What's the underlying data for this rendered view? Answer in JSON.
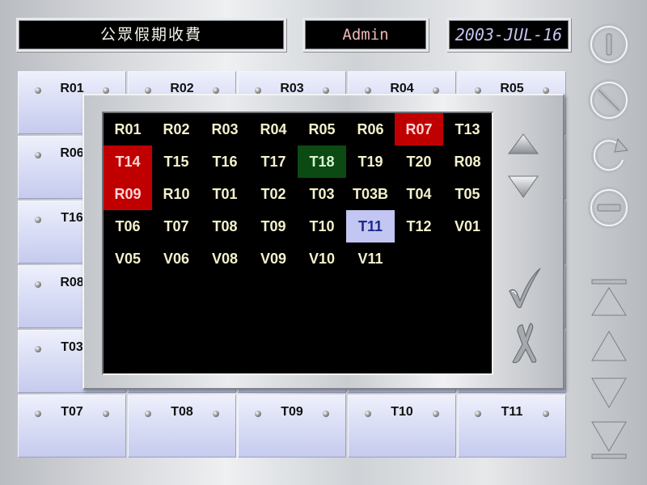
{
  "header": {
    "title": "公眾假期收費",
    "user": "Admin",
    "date": "2003-JUL-16"
  },
  "background_grid": {
    "rows": [
      [
        "R01",
        "R02",
        "R03",
        "R04",
        "R05"
      ],
      [
        "R06",
        "",
        "",
        "",
        ""
      ],
      [
        "T16",
        "",
        "",
        "",
        ""
      ],
      [
        "R08",
        "",
        "",
        "",
        ""
      ],
      [
        "T03",
        "",
        "",
        "",
        ""
      ],
      [
        "T07",
        "T08",
        "T09",
        "T10",
        "T11"
      ]
    ],
    "visible_partial_labels": [
      "R01",
      "R02",
      "R03",
      "R04",
      "R05",
      "R06",
      "T16",
      "R08",
      "T03",
      "T07",
      "T08",
      "T09",
      "T10",
      "T11"
    ]
  },
  "popup": {
    "rooms": [
      {
        "label": "R01",
        "state": "normal"
      },
      {
        "label": "R02",
        "state": "normal"
      },
      {
        "label": "R03",
        "state": "normal"
      },
      {
        "label": "R04",
        "state": "normal"
      },
      {
        "label": "R05",
        "state": "normal"
      },
      {
        "label": "R06",
        "state": "normal"
      },
      {
        "label": "R07",
        "state": "red"
      },
      {
        "label": "T13",
        "state": "normal"
      },
      {
        "label": "T14",
        "state": "red"
      },
      {
        "label": "T15",
        "state": "normal"
      },
      {
        "label": "T16",
        "state": "normal"
      },
      {
        "label": "T17",
        "state": "normal"
      },
      {
        "label": "T18",
        "state": "green"
      },
      {
        "label": "T19",
        "state": "normal"
      },
      {
        "label": "T20",
        "state": "normal"
      },
      {
        "label": "R08",
        "state": "normal"
      },
      {
        "label": "R09",
        "state": "red"
      },
      {
        "label": "R10",
        "state": "normal"
      },
      {
        "label": "T01",
        "state": "normal"
      },
      {
        "label": "T02",
        "state": "normal"
      },
      {
        "label": "T03",
        "state": "normal"
      },
      {
        "label": "T03B",
        "state": "normal"
      },
      {
        "label": "T04",
        "state": "normal"
      },
      {
        "label": "T05",
        "state": "normal"
      },
      {
        "label": "T06",
        "state": "normal"
      },
      {
        "label": "T07",
        "state": "normal"
      },
      {
        "label": "T08",
        "state": "normal"
      },
      {
        "label": "T09",
        "state": "normal"
      },
      {
        "label": "T10",
        "state": "normal"
      },
      {
        "label": "T11",
        "state": "selected"
      },
      {
        "label": "T12",
        "state": "normal"
      },
      {
        "label": "V01",
        "state": "normal"
      },
      {
        "label": "V05",
        "state": "normal"
      },
      {
        "label": "V06",
        "state": "normal"
      },
      {
        "label": "V08",
        "state": "normal"
      },
      {
        "label": "V09",
        "state": "normal"
      },
      {
        "label": "V10",
        "state": "normal"
      },
      {
        "label": "V11",
        "state": "normal"
      }
    ],
    "columns": 8,
    "controls": [
      "scroll-up-icon",
      "scroll-down-icon",
      "confirm-check-icon",
      "cancel-x-icon"
    ]
  },
  "rail": {
    "buttons": [
      "power-icon",
      "cancel-circle-icon",
      "refresh-icon",
      "minus-circle-icon",
      "first-page-icon",
      "page-up-icon",
      "page-down-icon",
      "last-page-icon"
    ]
  },
  "colors": {
    "room_red": "#c00000",
    "room_green": "#0b4a12",
    "room_selected": "#c3c6f2",
    "room_text": "#f4f1cc"
  }
}
